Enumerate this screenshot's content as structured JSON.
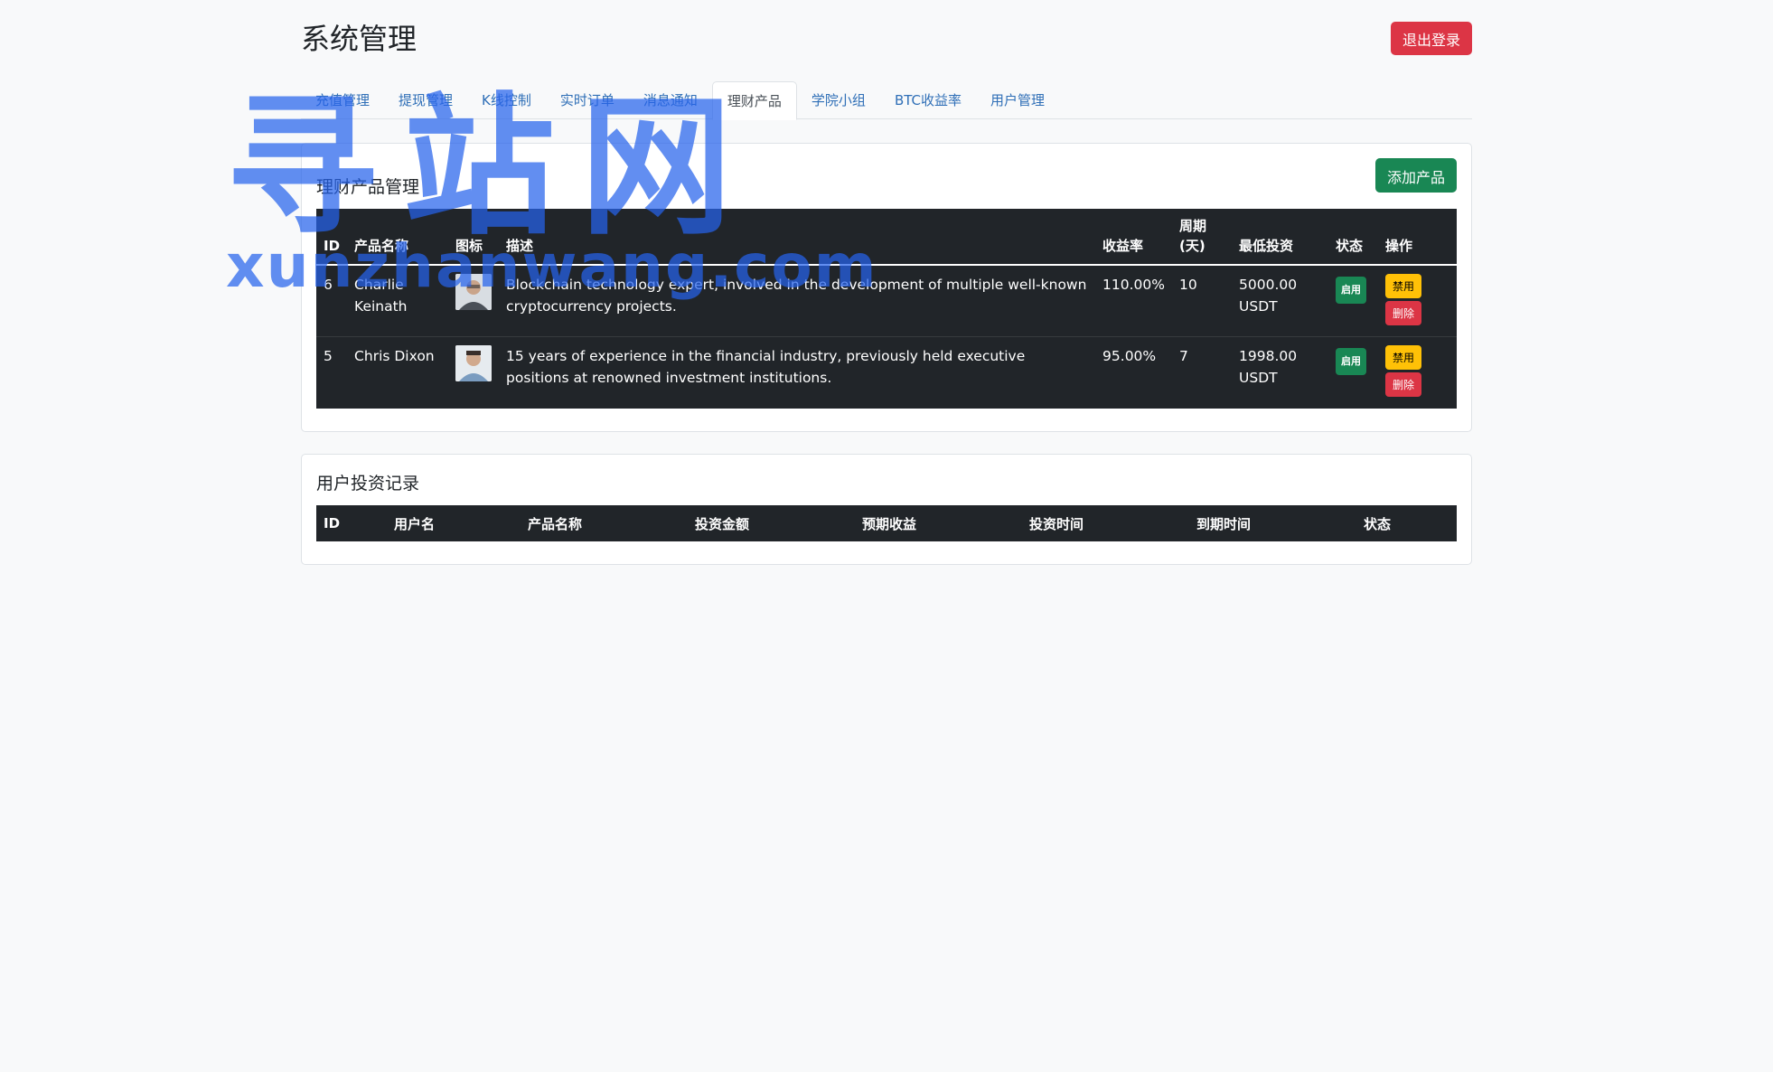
{
  "header": {
    "title": "系统管理",
    "logout_label": "退出登录"
  },
  "tabs": [
    {
      "label": "充值管理"
    },
    {
      "label": "提现管理"
    },
    {
      "label": "K线控制"
    },
    {
      "label": "实时订单"
    },
    {
      "label": "消息通知"
    },
    {
      "label": "理财产品",
      "active": true
    },
    {
      "label": "学院小组"
    },
    {
      "label": "BTC收益率"
    },
    {
      "label": "用户管理"
    }
  ],
  "products": {
    "title": "理财产品管理",
    "add_label": "添加产品",
    "columns": [
      "ID",
      "产品名称",
      "图标",
      "描述",
      "收益率",
      "周期\n(天)",
      "最低投资",
      "状态",
      "操作"
    ],
    "rows": [
      {
        "id": "6",
        "name": "Charlie Keinath",
        "description": "Blockchain technology expert, involved in the development of multiple well-known cryptocurrency projects.",
        "rate": "110.00%",
        "period": "10",
        "min_invest": "5000.00 USDT",
        "status": "启用",
        "action_disable": "禁用",
        "action_delete": "删除"
      },
      {
        "id": "5",
        "name": "Chris Dixon",
        "description": "15 years of experience in the financial industry, previously held executive positions at renowned investment institutions.",
        "rate": "95.00%",
        "period": "7",
        "min_invest": "1998.00 USDT",
        "status": "启用",
        "action_disable": "禁用",
        "action_delete": "删除"
      }
    ]
  },
  "investments": {
    "title": "用户投资记录",
    "columns": [
      "ID",
      "用户名",
      "产品名称",
      "投资金额",
      "预期收益",
      "投资时间",
      "到期时间",
      "状态"
    ]
  },
  "watermark": {
    "main": "寻站网",
    "sub": "xunzhanwang.com"
  },
  "colors": {
    "danger": "#dc3545",
    "success": "#198754",
    "warning": "#ffc107",
    "dark": "#212529",
    "link": "#2f6fb7"
  }
}
